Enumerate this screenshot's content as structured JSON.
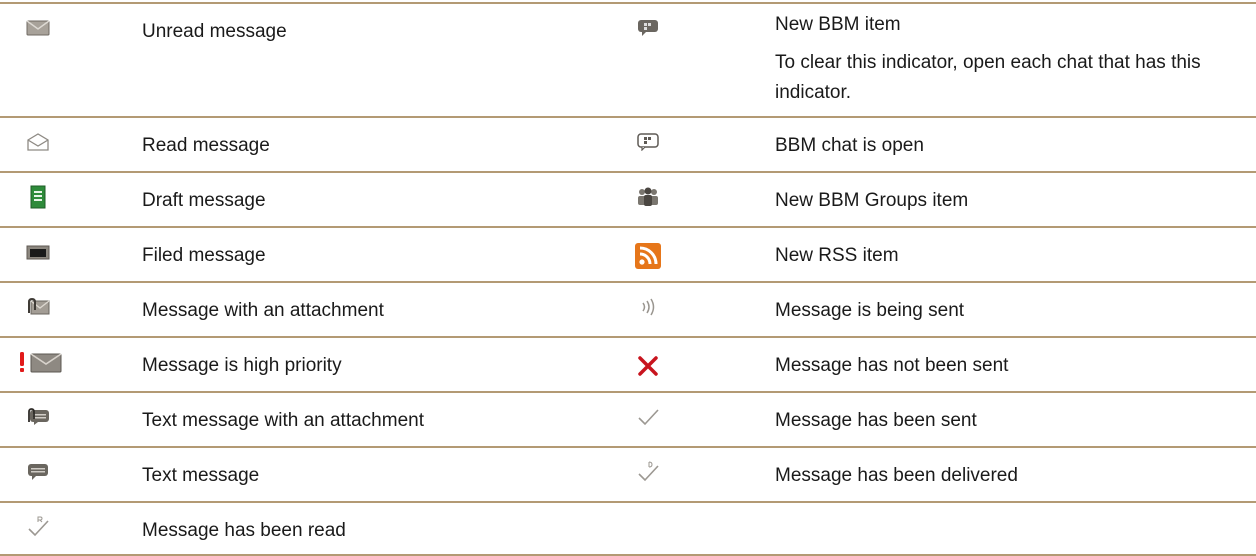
{
  "rows": [
    {
      "left": {
        "icon": "unread-envelope-icon",
        "label": "Unread message"
      },
      "right": {
        "icon": "bbm-new-item-icon",
        "label": "New BBM item",
        "note": "To clear this indicator, open each chat that has this indicator."
      }
    },
    {
      "left": {
        "icon": "read-envelope-icon",
        "label": "Read message"
      },
      "right": {
        "icon": "bbm-chat-open-icon",
        "label": "BBM chat is open"
      }
    },
    {
      "left": {
        "icon": "draft-document-icon",
        "label": "Draft message"
      },
      "right": {
        "icon": "bbm-groups-icon",
        "label": "New BBM Groups item"
      }
    },
    {
      "left": {
        "icon": "filed-folder-icon",
        "label": "Filed message"
      },
      "right": {
        "icon": "rss-icon",
        "label": "New RSS item"
      }
    },
    {
      "left": {
        "icon": "attachment-envelope-icon",
        "label": "Message with an attachment"
      },
      "right": {
        "icon": "sending-waves-icon",
        "label": "Message is being sent"
      }
    },
    {
      "left": {
        "icon": "high-priority-envelope-icon",
        "label": "Message is high priority"
      },
      "right": {
        "icon": "red-x-icon",
        "label": "Message has not been sent"
      }
    },
    {
      "left": {
        "icon": "text-attachment-icon",
        "label": "Text message with an attachment"
      },
      "right": {
        "icon": "checkmark-icon",
        "label": "Message has been sent"
      }
    },
    {
      "left": {
        "icon": "text-message-icon",
        "label": "Text message"
      },
      "right": {
        "icon": "delivered-check-icon",
        "label": "Message has been delivered"
      }
    },
    {
      "left": {
        "icon": "read-check-icon",
        "label": "Message has been read"
      },
      "right": null
    }
  ]
}
